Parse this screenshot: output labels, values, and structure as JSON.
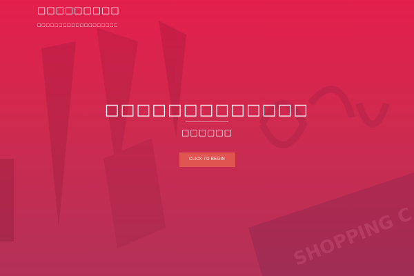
{
  "header": {
    "site_title": "□□□□□□□□□",
    "tagline": "□□□□□□□□□□□□□□□□□□□"
  },
  "hero": {
    "title": "□□□□□□□□□□□□□",
    "subtitle": "□□□□□□",
    "cta_label": "CLICK TO BEGIN"
  },
  "colors": {
    "background_top": "#e31f4c",
    "background_bottom": "#b33158",
    "button": "#e0554f",
    "text": "#ffffff"
  },
  "background": {
    "sign_text": "SHOPPING C"
  }
}
